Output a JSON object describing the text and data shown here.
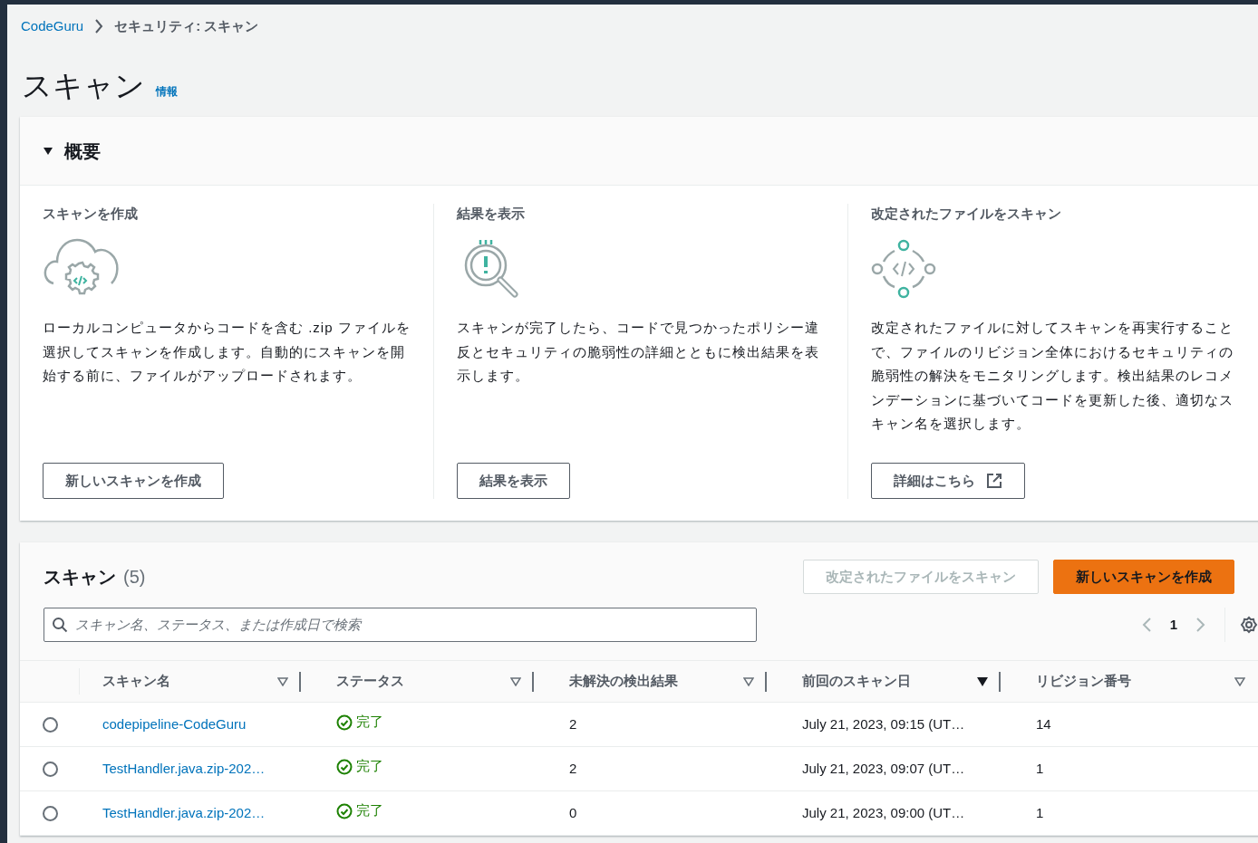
{
  "breadcrumb": [
    {
      "label": "CodeGuru",
      "link": true
    },
    {
      "label": "セキュリティ: スキャン",
      "link": false
    }
  ],
  "page_title": "スキャン",
  "info_link": "情報",
  "overview": {
    "title": "概要",
    "expanded": true,
    "columns": [
      {
        "kind": "cloud",
        "title": "スキャンを作成",
        "text": "ローカルコンピュータからコードを含む .zip ファイルを選択してスキャンを作成します。自動的にスキャンを開始する前に、ファイルがアップロードされます。",
        "button": "新しいスキャンを作成",
        "external": false
      },
      {
        "kind": "magnifier",
        "title": "結果を表示",
        "text": "スキャンが完了したら、コードで見つかったポリシー違反とセキュリティの脆弱性の詳細とともに検出結果を表示します。",
        "button": "結果を表示",
        "external": false
      },
      {
        "kind": "cycle",
        "title": "改定されたファイルをスキャン",
        "text": "改定されたファイルに対してスキャンを再実行することで、ファイルのリビジョン全体におけるセキュリティの脆弱性の解決をモニタリングします。検出結果のレコメンデーションに基づいてコードを更新した後、適切なスキャン名を選択します。",
        "button": "詳細はこちら",
        "external": true
      }
    ]
  },
  "scans": {
    "title": "スキャン",
    "count": "(5)",
    "actions": [
      {
        "label": "改定されたファイルをスキャン",
        "kind": "normal",
        "disabled": true
      },
      {
        "label": "新しいスキャンを作成",
        "kind": "primary",
        "disabled": false
      }
    ],
    "search": {
      "placeholder": "スキャン名、ステータス、または作成日で検索"
    },
    "pagination": {
      "page": "1",
      "prev_disabled": true,
      "next_disabled": true
    },
    "columns": [
      {
        "label": "スキャン名",
        "sorted": false
      },
      {
        "label": "ステータス",
        "sorted": false
      },
      {
        "label": "未解決の検出結果",
        "sorted": false
      },
      {
        "label": "前回のスキャン日",
        "sorted": true
      },
      {
        "label": "リビジョン番号",
        "sorted": false
      }
    ],
    "rows": [
      {
        "selected": false,
        "name": "codepipeline-CodeGuru",
        "status": {
          "kind": "success",
          "label": "完了"
        },
        "findings": "2",
        "date": "July 21, 2023, 09:15 (UT…",
        "revision": "14"
      },
      {
        "selected": false,
        "name": "TestHandler.java.zip-202…",
        "status": {
          "kind": "success",
          "label": "完了"
        },
        "findings": "2",
        "date": "July 21, 2023, 09:07 (UT…",
        "revision": "1"
      },
      {
        "selected": false,
        "name": "TestHandler.java.zip-202…",
        "status": {
          "kind": "success",
          "label": "完了"
        },
        "findings": "0",
        "date": "July 21, 2023, 09:00 (UT…",
        "revision": "1"
      }
    ]
  }
}
